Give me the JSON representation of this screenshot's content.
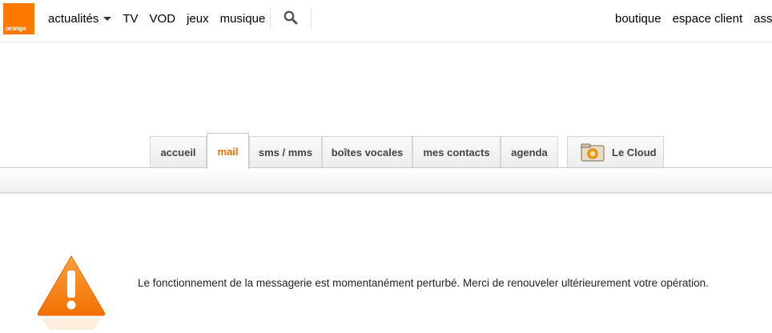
{
  "header": {
    "logo_text": "orange",
    "nav_left": [
      {
        "label": "actualités",
        "has_dropdown": true
      },
      {
        "label": "TV"
      },
      {
        "label": "VOD"
      },
      {
        "label": "jeux"
      },
      {
        "label": "musique"
      }
    ],
    "search_icon": "search-icon",
    "nav_right": [
      {
        "label": "boutique"
      },
      {
        "label": "espace client"
      },
      {
        "label": "assis"
      }
    ]
  },
  "tabs": [
    {
      "label": "accueil",
      "active": false
    },
    {
      "label": "mail",
      "active": true
    },
    {
      "label": "sms / mms",
      "active": false
    },
    {
      "label": "boîtes vocales",
      "active": false
    },
    {
      "label": "mes contacts",
      "active": false
    },
    {
      "label": "agenda",
      "active": false
    },
    {
      "label": "Le Cloud",
      "active": false,
      "icon": "cloud-folder-icon"
    }
  ],
  "message": {
    "icon": "warning-icon",
    "text": "Le fonctionnement de la messagerie est momentanément perturbé. Merci de renouveler ultérieurement votre opération."
  },
  "colors": {
    "brand": "#ff7900",
    "active_tab": "#f16e00"
  }
}
